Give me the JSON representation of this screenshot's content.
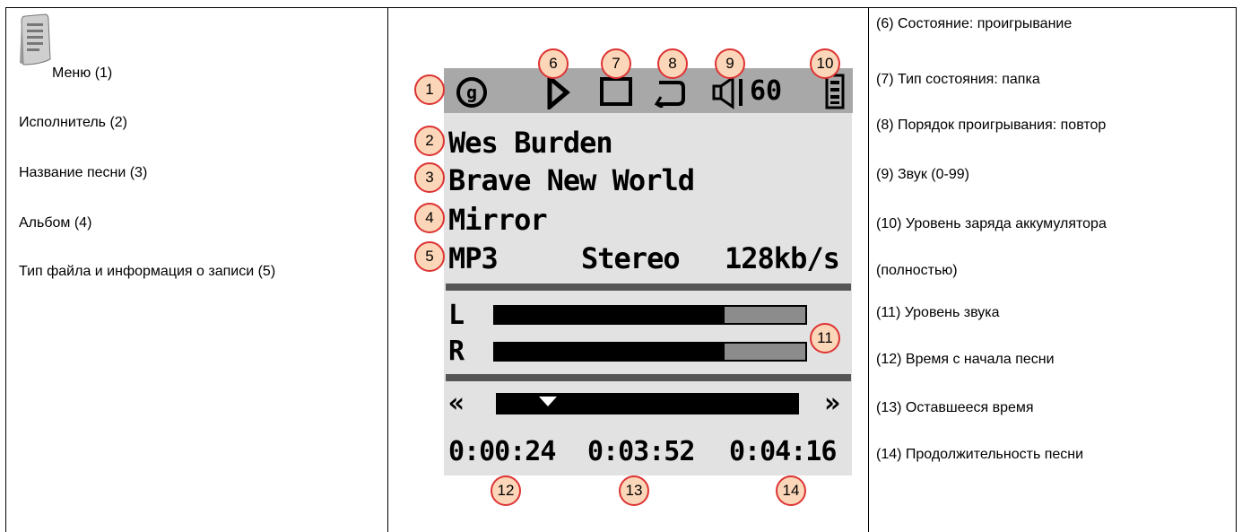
{
  "left_panel": {
    "icon": "menu-document-icon",
    "items": [
      "Меню (1)",
      "Исполнитель (2)",
      "Название песни  (3)",
      "Альбом (4)",
      "Тип файла и информация о записи (5)"
    ]
  },
  "player": {
    "status_bar": {
      "menu_icon": "settings-circle-icon",
      "play_state_icon": "play-icon",
      "mode_icon": "folder-square-icon",
      "repeat_icon": "repeat-icon",
      "speaker_icon": "speaker-icon",
      "volume": "60",
      "battery_icon": "battery-full-icon"
    },
    "artist": "Wes Burden",
    "title": "Brave New World",
    "album": "Mirror",
    "file_type": "MP3",
    "channel_mode": "Stereo",
    "bitrate": "128kb/s",
    "level_left_label": "L",
    "level_right_label": "R",
    "level_left": 0.74,
    "level_right": 0.74,
    "seek_back": "«",
    "seek_forward": "»",
    "progress": 0.09,
    "elapsed": "0:00:24",
    "remaining": "0:03:52",
    "duration": "0:04:16"
  },
  "callouts": [
    "1",
    "2",
    "3",
    "4",
    "5",
    "6",
    "7",
    "8",
    "9",
    "10",
    "11",
    "12",
    "13",
    "14"
  ],
  "legend": [
    "(6) Состояние: проигрывание",
    "(7) Тип состояния: папка",
    "(8) Порядок проигрывания: повтор",
    "(9) Звук (0-99)",
    "(10) Уровень заряда аккумулятора",
    "(полностью)",
    "(11) Уровень звука",
    "(12) Время с начала песни",
    "(13) Оставшееся время",
    "(14) Продолжительность песни"
  ],
  "colors": {
    "callout_fill": "#fbd6b8",
    "callout_border": "#dd3333",
    "screen_bg": "#e2e2e2",
    "status_bar": "#a8a8a8"
  }
}
